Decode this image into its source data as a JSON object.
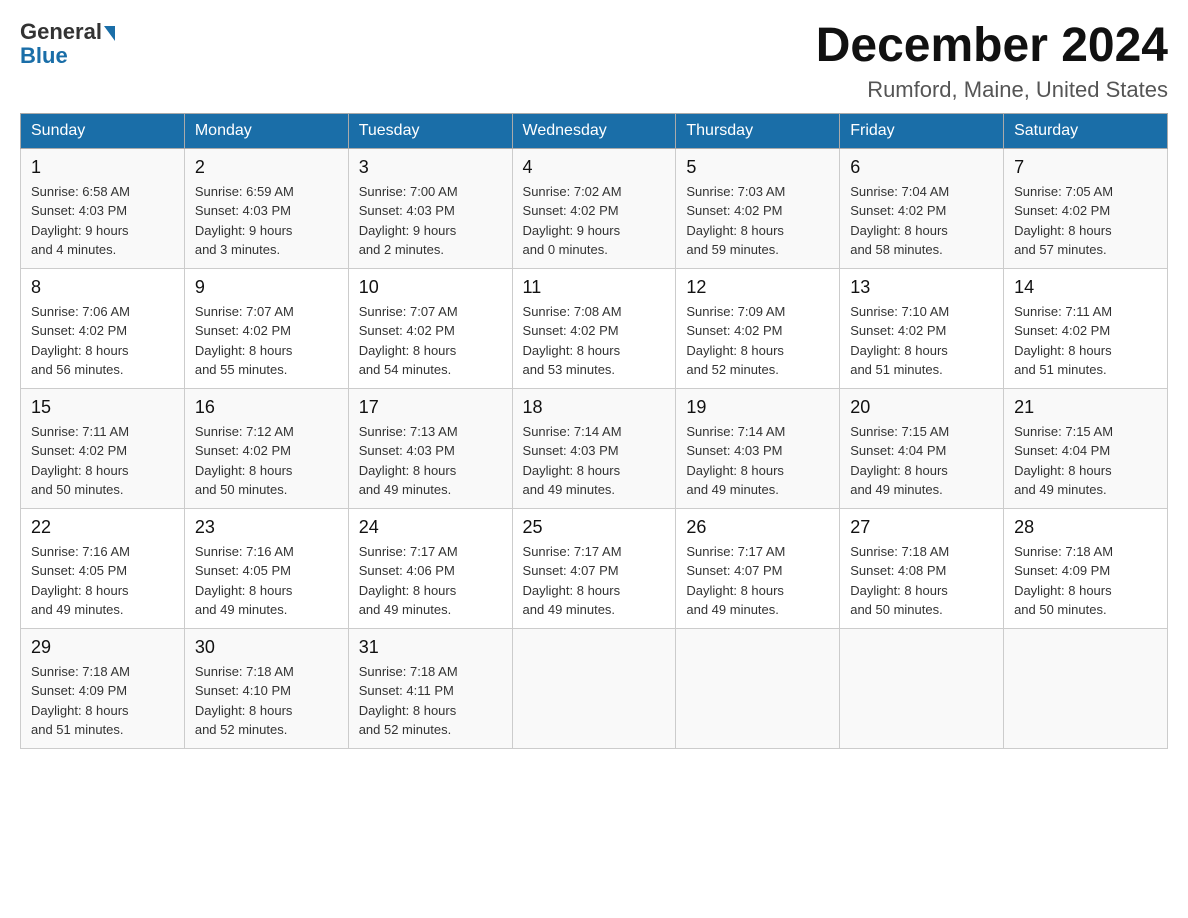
{
  "header": {
    "logo_line1": "General",
    "logo_line2": "Blue",
    "month_title": "December 2024",
    "location": "Rumford, Maine, United States"
  },
  "days_of_week": [
    "Sunday",
    "Monday",
    "Tuesday",
    "Wednesday",
    "Thursday",
    "Friday",
    "Saturday"
  ],
  "weeks": [
    [
      {
        "day": "1",
        "sunrise": "6:58 AM",
        "sunset": "4:03 PM",
        "daylight": "9 hours and 4 minutes."
      },
      {
        "day": "2",
        "sunrise": "6:59 AM",
        "sunset": "4:03 PM",
        "daylight": "9 hours and 3 minutes."
      },
      {
        "day": "3",
        "sunrise": "7:00 AM",
        "sunset": "4:03 PM",
        "daylight": "9 hours and 2 minutes."
      },
      {
        "day": "4",
        "sunrise": "7:02 AM",
        "sunset": "4:02 PM",
        "daylight": "9 hours and 0 minutes."
      },
      {
        "day": "5",
        "sunrise": "7:03 AM",
        "sunset": "4:02 PM",
        "daylight": "8 hours and 59 minutes."
      },
      {
        "day": "6",
        "sunrise": "7:04 AM",
        "sunset": "4:02 PM",
        "daylight": "8 hours and 58 minutes."
      },
      {
        "day": "7",
        "sunrise": "7:05 AM",
        "sunset": "4:02 PM",
        "daylight": "8 hours and 57 minutes."
      }
    ],
    [
      {
        "day": "8",
        "sunrise": "7:06 AM",
        "sunset": "4:02 PM",
        "daylight": "8 hours and 56 minutes."
      },
      {
        "day": "9",
        "sunrise": "7:07 AM",
        "sunset": "4:02 PM",
        "daylight": "8 hours and 55 minutes."
      },
      {
        "day": "10",
        "sunrise": "7:07 AM",
        "sunset": "4:02 PM",
        "daylight": "8 hours and 54 minutes."
      },
      {
        "day": "11",
        "sunrise": "7:08 AM",
        "sunset": "4:02 PM",
        "daylight": "8 hours and 53 minutes."
      },
      {
        "day": "12",
        "sunrise": "7:09 AM",
        "sunset": "4:02 PM",
        "daylight": "8 hours and 52 minutes."
      },
      {
        "day": "13",
        "sunrise": "7:10 AM",
        "sunset": "4:02 PM",
        "daylight": "8 hours and 51 minutes."
      },
      {
        "day": "14",
        "sunrise": "7:11 AM",
        "sunset": "4:02 PM",
        "daylight": "8 hours and 51 minutes."
      }
    ],
    [
      {
        "day": "15",
        "sunrise": "7:11 AM",
        "sunset": "4:02 PM",
        "daylight": "8 hours and 50 minutes."
      },
      {
        "day": "16",
        "sunrise": "7:12 AM",
        "sunset": "4:02 PM",
        "daylight": "8 hours and 50 minutes."
      },
      {
        "day": "17",
        "sunrise": "7:13 AM",
        "sunset": "4:03 PM",
        "daylight": "8 hours and 49 minutes."
      },
      {
        "day": "18",
        "sunrise": "7:14 AM",
        "sunset": "4:03 PM",
        "daylight": "8 hours and 49 minutes."
      },
      {
        "day": "19",
        "sunrise": "7:14 AM",
        "sunset": "4:03 PM",
        "daylight": "8 hours and 49 minutes."
      },
      {
        "day": "20",
        "sunrise": "7:15 AM",
        "sunset": "4:04 PM",
        "daylight": "8 hours and 49 minutes."
      },
      {
        "day": "21",
        "sunrise": "7:15 AM",
        "sunset": "4:04 PM",
        "daylight": "8 hours and 49 minutes."
      }
    ],
    [
      {
        "day": "22",
        "sunrise": "7:16 AM",
        "sunset": "4:05 PM",
        "daylight": "8 hours and 49 minutes."
      },
      {
        "day": "23",
        "sunrise": "7:16 AM",
        "sunset": "4:05 PM",
        "daylight": "8 hours and 49 minutes."
      },
      {
        "day": "24",
        "sunrise": "7:17 AM",
        "sunset": "4:06 PM",
        "daylight": "8 hours and 49 minutes."
      },
      {
        "day": "25",
        "sunrise": "7:17 AM",
        "sunset": "4:07 PM",
        "daylight": "8 hours and 49 minutes."
      },
      {
        "day": "26",
        "sunrise": "7:17 AM",
        "sunset": "4:07 PM",
        "daylight": "8 hours and 49 minutes."
      },
      {
        "day": "27",
        "sunrise": "7:18 AM",
        "sunset": "4:08 PM",
        "daylight": "8 hours and 50 minutes."
      },
      {
        "day": "28",
        "sunrise": "7:18 AM",
        "sunset": "4:09 PM",
        "daylight": "8 hours and 50 minutes."
      }
    ],
    [
      {
        "day": "29",
        "sunrise": "7:18 AM",
        "sunset": "4:09 PM",
        "daylight": "8 hours and 51 minutes."
      },
      {
        "day": "30",
        "sunrise": "7:18 AM",
        "sunset": "4:10 PM",
        "daylight": "8 hours and 52 minutes."
      },
      {
        "day": "31",
        "sunrise": "7:18 AM",
        "sunset": "4:11 PM",
        "daylight": "8 hours and 52 minutes."
      },
      null,
      null,
      null,
      null
    ]
  ],
  "labels": {
    "sunrise": "Sunrise:",
    "sunset": "Sunset:",
    "daylight": "Daylight:"
  }
}
